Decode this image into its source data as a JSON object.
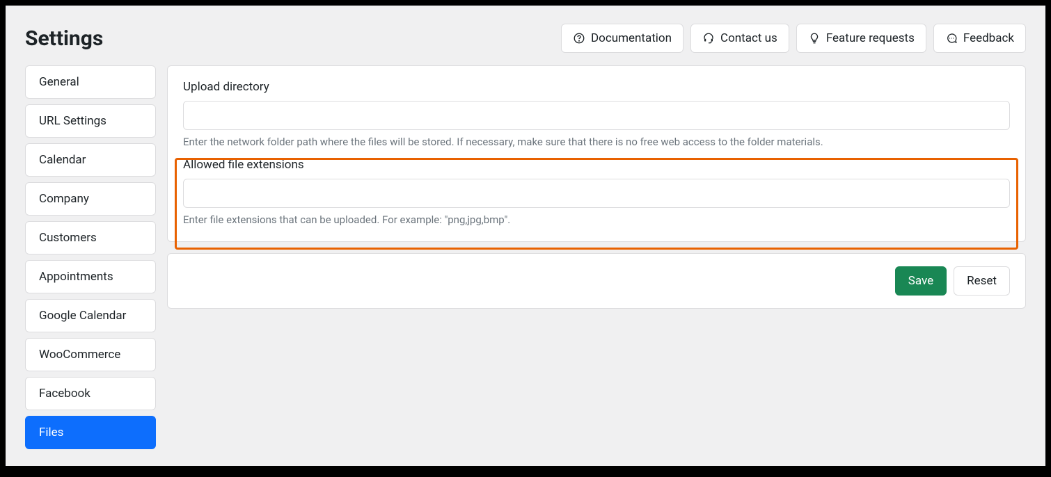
{
  "header": {
    "title": "Settings",
    "buttons": {
      "documentation": "Documentation",
      "contact": "Contact us",
      "feature_requests": "Feature requests",
      "feedback": "Feedback"
    }
  },
  "sidebar": {
    "items": [
      {
        "label": "General",
        "active": false
      },
      {
        "label": "URL Settings",
        "active": false
      },
      {
        "label": "Calendar",
        "active": false
      },
      {
        "label": "Company",
        "active": false
      },
      {
        "label": "Customers",
        "active": false
      },
      {
        "label": "Appointments",
        "active": false
      },
      {
        "label": "Google Calendar",
        "active": false
      },
      {
        "label": "WooCommerce",
        "active": false
      },
      {
        "label": "Facebook",
        "active": false
      },
      {
        "label": "Files",
        "active": true
      }
    ]
  },
  "form": {
    "upload_directory": {
      "label": "Upload directory",
      "value": "",
      "help": "Enter the network folder path where the files will be stored. If necessary, make sure that there is no free web access to the folder materials."
    },
    "allowed_extensions": {
      "label": "Allowed file extensions",
      "value": "",
      "help": "Enter file extensions that can be uploaded. For example: \"png,jpg,bmp\"."
    }
  },
  "actions": {
    "save": "Save",
    "reset": "Reset"
  }
}
